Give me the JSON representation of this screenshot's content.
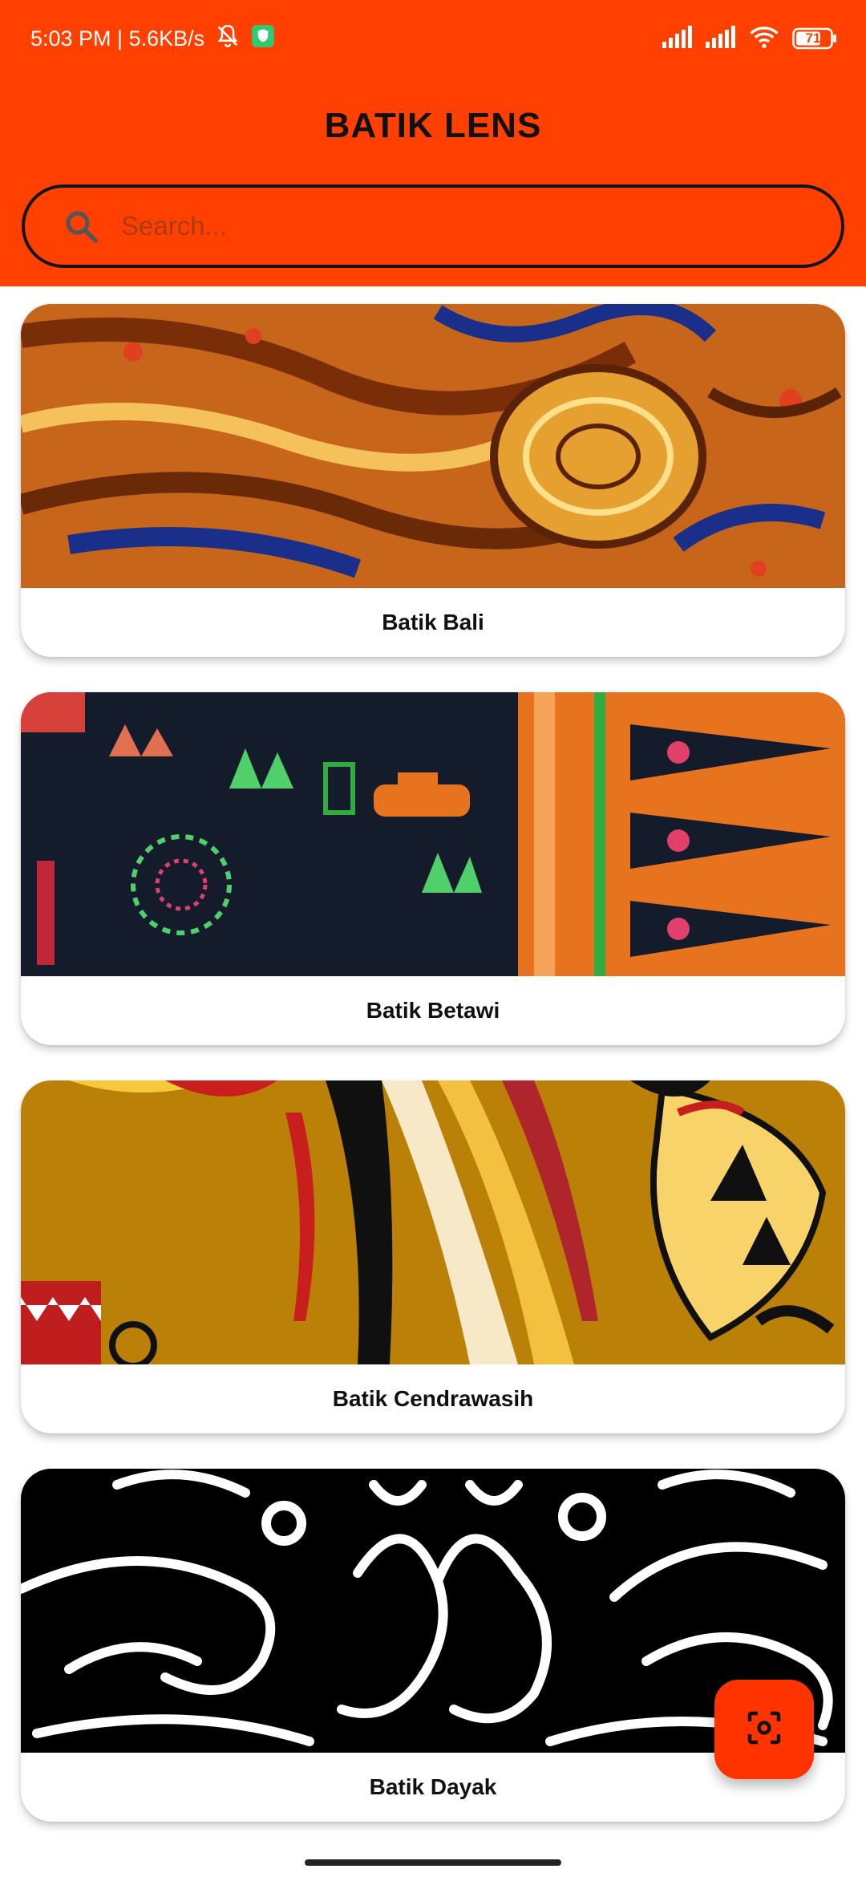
{
  "status_bar": {
    "time_speed": "5:03 PM | 5.6KB/s",
    "battery": "71",
    "icons": [
      "mute-bell-icon",
      "shield-icon",
      "signal-icon",
      "signal-icon",
      "wifi-icon",
      "battery-icon"
    ]
  },
  "app": {
    "title": "BATIK LENS"
  },
  "search": {
    "placeholder": "Search...",
    "value": "",
    "icon": "search-icon"
  },
  "items": [
    {
      "label": "Batik Bali"
    },
    {
      "label": "Batik Betawi"
    },
    {
      "label": "Batik Cendrawasih"
    },
    {
      "label": "Batik Dayak"
    }
  ],
  "fab": {
    "icon": "scan-icon"
  },
  "colors": {
    "header": "#FF4000",
    "fab": "#FF3300",
    "title": "#111111"
  }
}
